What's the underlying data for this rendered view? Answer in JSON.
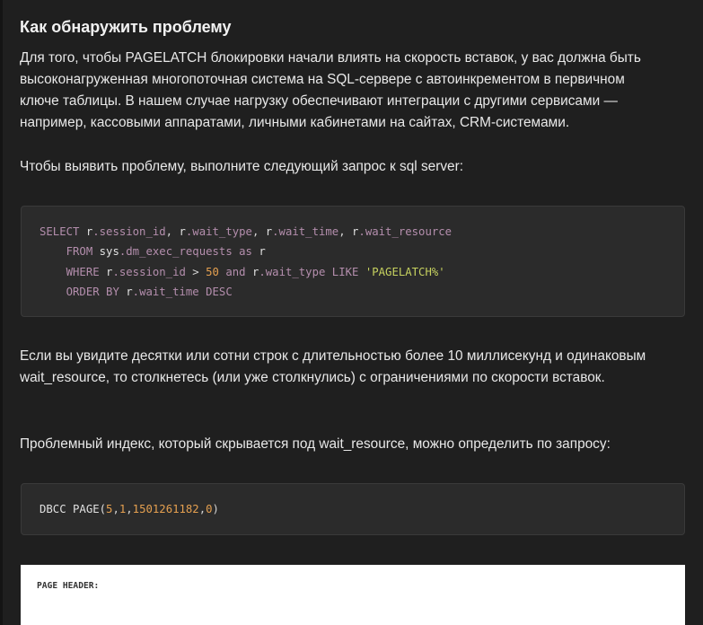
{
  "article": {
    "heading": "Как обнаружить проблему",
    "para1_line1": "Для того, чтобы PAGELATCH блокировки начали влиять на скорость вставок, у вас должна быть",
    "para1_line2": "высоконагруженная многопоточная система на SQL-сервере с автоинкрементом в первичном",
    "para1_line3": "ключе таблицы. В нашем случае нагрузку обеспечивают интеграции с другими сервисами —",
    "para1_line4": "например, кассовыми аппаратами, личными кабинетами на сайтах, CRM-системами.",
    "para2": "Чтобы выявить проблему, выполните следующий запрос к sql server:",
    "para3_line1": "Если вы увидите десятки или сотни строк с длительностью более 10 миллисекунд и одинаковым",
    "para3_line2": "wait_resource, то столкнетесь (или уже столкнулись) с ограничениями по скорости вставок.",
    "para4": "Проблемный индекс, который скрывается под wait_resource, можно определить по запросу:"
  },
  "code1": {
    "l1_select": "SELECT ",
    "l1_r1": "r",
    "l1_f1": ".session_id",
    "l1_sep1": ", ",
    "l1_r2": "r",
    "l1_f2": ".wait_type",
    "l1_sep2": ", ",
    "l1_r3": "r",
    "l1_f3": ".wait_time",
    "l1_sep3": ", ",
    "l1_r4": "r",
    "l1_f4": ".wait_resource",
    "l2_from": "FROM ",
    "l2_sys": "sys",
    "l2_view": ".dm_exec_requests",
    "l2_as": " as ",
    "l2_alias": "r",
    "l3_where": "WHERE ",
    "l3_r1": "r",
    "l3_f1": ".session_id",
    "l3_gt": " > ",
    "l3_num": "50",
    "l3_and": " and ",
    "l3_r2": "r",
    "l3_f2": ".wait_type",
    "l3_like": " LIKE ",
    "l3_str": "'PAGELATCH%'",
    "l4_order": "ORDER BY ",
    "l4_r": "r",
    "l4_f": ".wait_time",
    "l4_desc": " DESC"
  },
  "code2": {
    "fn": "DBCC PAGE(",
    "a1": "5",
    "c1": ",",
    "a2": "1",
    "c2": ",",
    "a3": "1501261182",
    "c3": ",",
    "a4": "0",
    "close": ")"
  },
  "output_panel": {
    "header": "PAGE HEADER:"
  },
  "colors": {
    "background": "#1f1f1f",
    "code_background": "#2b2b2b",
    "keyword": "#b48ead",
    "number": "#e5a050",
    "string": "#c6d15f"
  }
}
